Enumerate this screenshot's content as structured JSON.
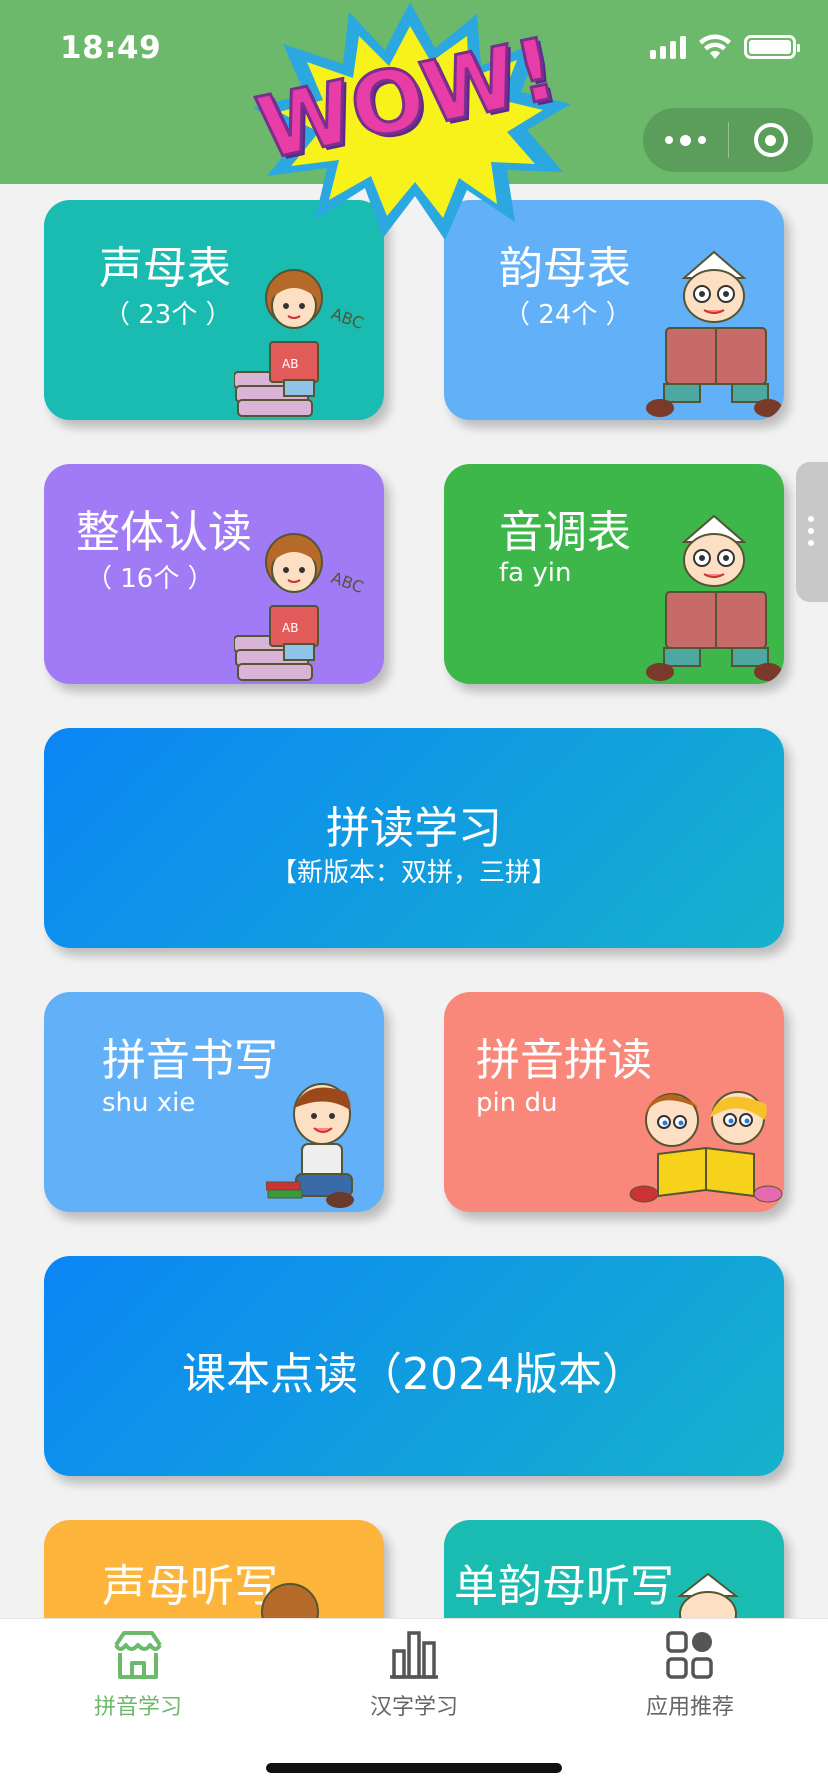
{
  "status_bar": {
    "time": "18:49"
  },
  "cards": {
    "shengmu": {
      "title": "声母表",
      "sub": "（ 23个 ）"
    },
    "yunmu": {
      "title": "韵母表",
      "sub": "（ 24个 ）"
    },
    "zhengti": {
      "title": "整体认读",
      "sub": "（ 16个 ）"
    },
    "yindiao": {
      "title": "音调表",
      "sub": "fa yin"
    },
    "pindu_study": {
      "title": "拼读学习",
      "sub": "【新版本：双拼，三拼】"
    },
    "shuxie": {
      "title": "拼音书写",
      "sub": "shu xie"
    },
    "pindu": {
      "title": "拼音拼读",
      "sub": "pin du"
    },
    "kebendiandu": {
      "title": "课本点读（2024版本）"
    },
    "shengmu_tingxie": {
      "title": "声母听写"
    },
    "danyunmu_tingxie": {
      "title": "单韵母听写"
    }
  },
  "tabbar": {
    "items": [
      {
        "label": "拼音学习",
        "icon": "store-icon",
        "active": true
      },
      {
        "label": "汉字学习",
        "icon": "bar-chart-icon",
        "active": false
      },
      {
        "label": "应用推荐",
        "icon": "apps-grid-icon",
        "active": false
      }
    ]
  },
  "colors": {
    "header": "#6cb96c",
    "active_tab": "#6cb96c",
    "teal": "#1abcb1",
    "sky": "#62b1f8",
    "purple": "#a17bf5",
    "green": "#3db64a",
    "salmon": "#f9887a",
    "orange": "#fcb43a"
  },
  "decor": {
    "wow_text": "WOW!"
  }
}
